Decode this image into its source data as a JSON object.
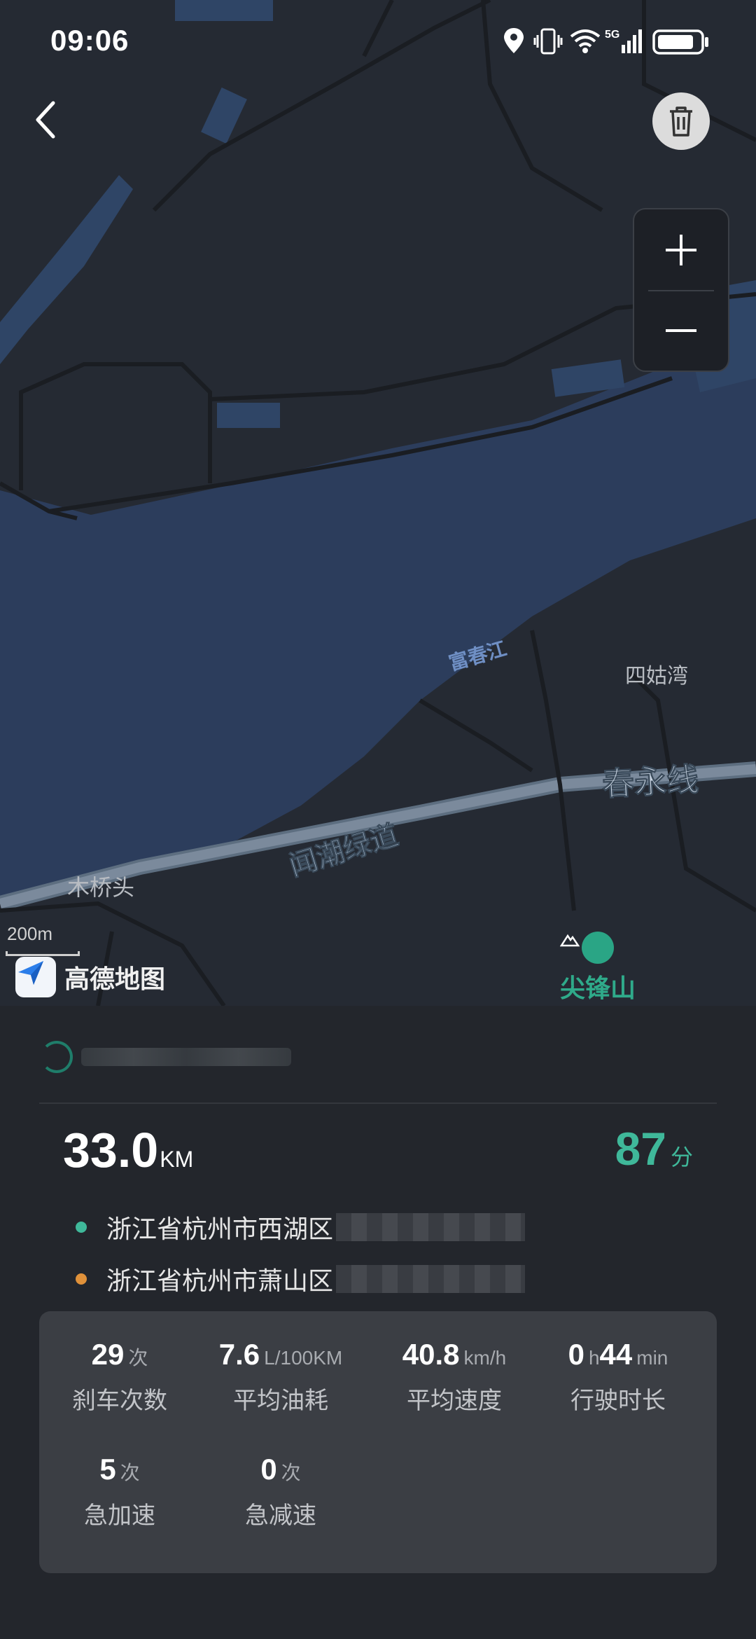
{
  "status_bar": {
    "time": "09:06"
  },
  "map": {
    "labels": {
      "river": "富春江",
      "place_sigu": "四姑湾",
      "road_chunyong": "春永线",
      "greenway": "闻潮绿道",
      "place_muqiao": "木桥头",
      "poi": "尖锋山"
    },
    "scale": "200m",
    "provider": "高德地图",
    "zoom_in_label": "+",
    "zoom_out_label": "—"
  },
  "trip": {
    "distance_value": "33.0",
    "distance_unit": "KM",
    "score_value": "87",
    "score_unit": "分",
    "start_address": "浙江省杭州市西湖区",
    "end_address": "浙江省杭州市萧山区"
  },
  "stats": [
    {
      "value": "29",
      "unit": "次",
      "label": "刹车次数"
    },
    {
      "value": "7.6",
      "unit": "L/100KM",
      "label": "平均油耗"
    },
    {
      "value": "40.8",
      "unit": "km/h",
      "label": "平均速度"
    },
    {
      "value": "0",
      "unit": "h",
      "value2": "44",
      "unit2": "min",
      "label": "行驶时长"
    },
    {
      "value": "5",
      "unit": "次",
      "label": "急加速"
    },
    {
      "value": "0",
      "unit": "次",
      "label": "急减速"
    }
  ],
  "colors": {
    "accent": "#3fb89a",
    "start_dot": "#3fb89a",
    "end_dot": "#e0913a",
    "map_land": "#252a33",
    "map_water": "#2c3d5c"
  }
}
